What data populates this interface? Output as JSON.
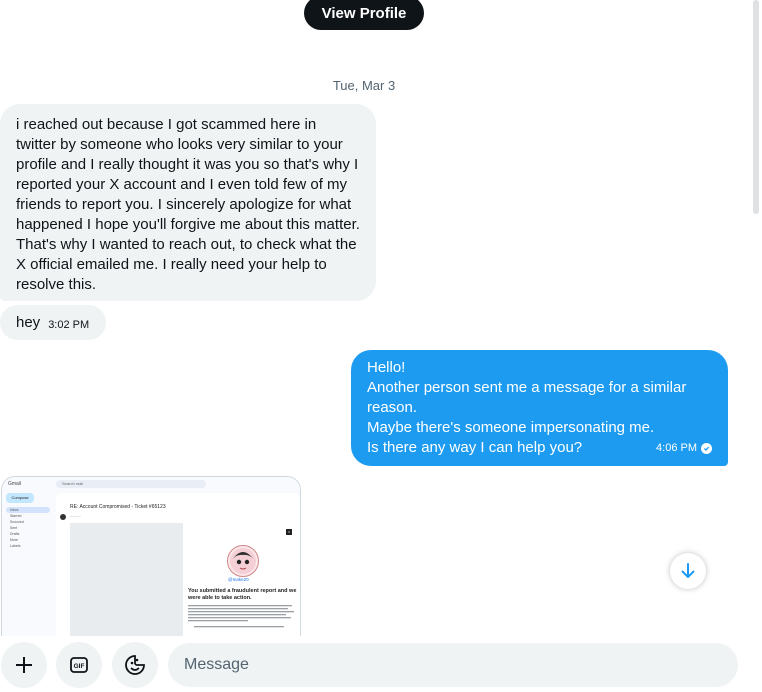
{
  "header": {
    "view_profile_label": "View Profile"
  },
  "date_separator": "Tue, Mar 3",
  "messages": [
    {
      "direction": "incoming",
      "text": "i  reached out because I got scammed here in twitter by someone who looks very similar to your profile and I really thought it was you so that's why I reported your X account and I even told few of my friends to report you. I sincerely apologize for what happened I hope you'll forgive me about this matter. That's why I wanted to reach out, to check what the X official emailed me. I really need your help to resolve this."
    },
    {
      "direction": "incoming",
      "text": "hey",
      "time": "3:02 PM"
    },
    {
      "direction": "outgoing",
      "lines": [
        "Hello!",
        "Another person sent me a message for a similar",
        "reason.",
        "Maybe there's someone impersonating me.",
        "Is there any way I can help you?"
      ],
      "time": "4:06 PM",
      "status_icon": "read-check-icon"
    }
  ],
  "attachment": {
    "app": "Gmail",
    "search_placeholder": "Search mail",
    "compose_label": "Compose",
    "sidebar": [
      "Inbox",
      "Starred",
      "Snoozed",
      "Sent",
      "Drafts",
      "More",
      "Labels"
    ],
    "subject": "RE: Account Compromised - Ticket #65123",
    "handle": "@Inake20",
    "notice_title": "You submitted a fraudulent report and we were able to take action."
  },
  "composer": {
    "placeholder": "Message",
    "buttons": [
      "plus-icon",
      "gif-icon",
      "emoji-icon"
    ]
  },
  "colors": {
    "accent": "#1d9bf0",
    "incoming_bubble": "#eff3f4",
    "dark_button": "#0f1419"
  }
}
